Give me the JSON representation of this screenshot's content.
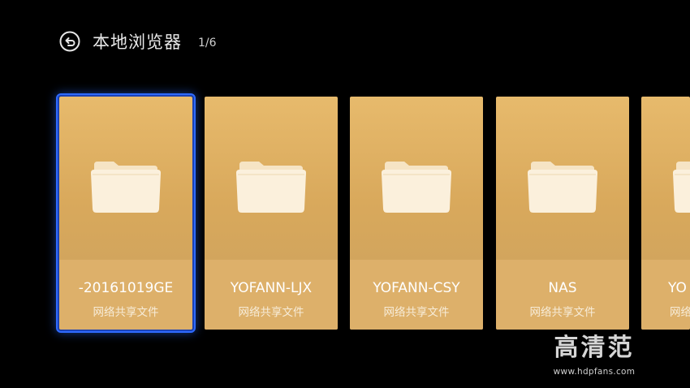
{
  "header": {
    "title": "本地浏览器",
    "page_counter": "1/6",
    "back_icon": "back-arrow-icon"
  },
  "cards": [
    {
      "name": "-20161019GE",
      "subtitle": "网络共享文件",
      "icon": "folder-icon",
      "focused": true
    },
    {
      "name": "YOFANN-LJX",
      "subtitle": "网络共享文件",
      "icon": "folder-icon",
      "focused": false
    },
    {
      "name": "YOFANN-CSY",
      "subtitle": "网络共享文件",
      "icon": "folder-icon",
      "focused": false
    },
    {
      "name": "NAS",
      "subtitle": "网络共享文件",
      "icon": "folder-icon",
      "focused": false
    },
    {
      "name": "YO",
      "subtitle": "网络",
      "icon": "folder-icon",
      "focused": false
    }
  ],
  "watermark": {
    "logo": "高清范",
    "url": "www.hdpfans.com"
  },
  "colors": {
    "background": "#000000",
    "card": "#deb066",
    "focus": "#2f6bff"
  }
}
